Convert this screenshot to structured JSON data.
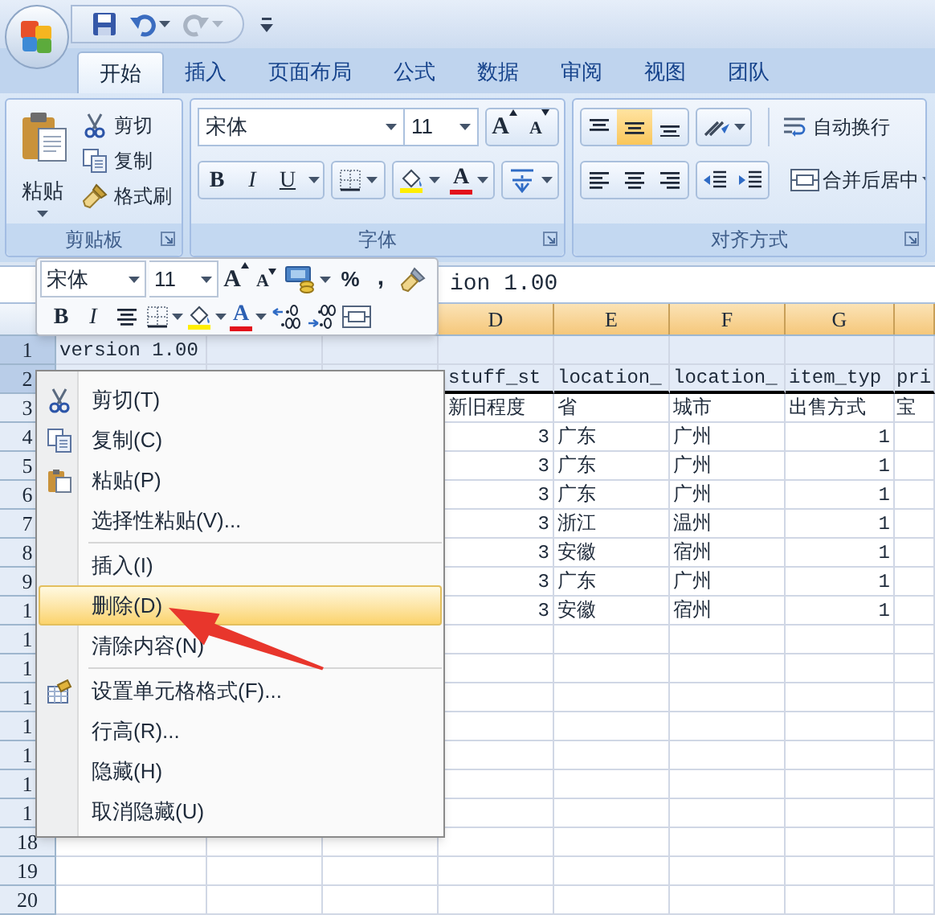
{
  "quick_access": [
    {
      "kind": "save",
      "disabled": false
    },
    {
      "kind": "undo",
      "disabled": false
    },
    {
      "kind": "redo",
      "disabled": true
    }
  ],
  "tabs": [
    {
      "label": "开始",
      "selected": true
    },
    {
      "label": "插入",
      "selected": false
    },
    {
      "label": "页面布局",
      "selected": false
    },
    {
      "label": "公式",
      "selected": false
    },
    {
      "label": "数据",
      "selected": false
    },
    {
      "label": "审阅",
      "selected": false
    },
    {
      "label": "视图",
      "selected": false
    },
    {
      "label": "团队",
      "selected": false
    }
  ],
  "ribbon": {
    "clipboard": {
      "label": "剪贴板",
      "paste": "粘贴",
      "commands": [
        {
          "kind": "cut",
          "label": "剪切"
        },
        {
          "kind": "copy",
          "label": "复制"
        },
        {
          "kind": "format_painter",
          "label": "格式刷"
        }
      ]
    },
    "font": {
      "label": "字体",
      "font_name": "宋体",
      "font_size": "11",
      "grow": "A",
      "shrink": "A",
      "styles": [
        "B",
        "I",
        "U"
      ],
      "font_color_letter": "A"
    },
    "alignment": {
      "label": "对齐方式",
      "vertical": [
        {
          "kind": "top",
          "selected": false
        },
        {
          "kind": "middle",
          "selected": true
        },
        {
          "kind": "bottom",
          "selected": false
        }
      ],
      "horizontal": [
        {
          "kind": "left",
          "selected": false
        },
        {
          "kind": "center",
          "selected": false
        },
        {
          "kind": "right",
          "selected": false
        }
      ],
      "wrap_text": "自动换行",
      "merge_center": "合并后居中"
    }
  },
  "formula_bar": {
    "value": "ion 1.00"
  },
  "mini_toolbar": {
    "font_name": "宋体",
    "font_size": "11",
    "grow": "A",
    "shrink": "A",
    "percent": "%",
    "comma": ",",
    "bold": "B",
    "italic": "I",
    "font_color_letter": "A"
  },
  "sheet": {
    "columns": [
      {
        "label": "D",
        "selected": true
      },
      {
        "label": "E",
        "selected": true
      },
      {
        "label": "F",
        "selected": true
      },
      {
        "label": "G",
        "selected": true
      },
      {
        "selected": true
      }
    ],
    "rows": [
      {
        "number": "1",
        "selected": true,
        "kind": "title",
        "a": "version 1.00"
      },
      {
        "number": "2",
        "selected": true,
        "kind": "fields",
        "d": "stuff_st",
        "e": "location_",
        "f": "location_",
        "g": "item_typ",
        "h": "pri"
      },
      {
        "number": "3",
        "selected": false,
        "kind": "text",
        "d": "新旧程度",
        "e": "省",
        "f": "城市",
        "g": "出售方式",
        "h": "宝"
      },
      {
        "number": "4",
        "selected": false,
        "kind": "data",
        "d": "3",
        "e": "广东",
        "f": "广州",
        "g": "1"
      },
      {
        "number": "5",
        "selected": false,
        "kind": "data",
        "d": "3",
        "e": "广东",
        "f": "广州",
        "g": "1"
      },
      {
        "number": "6",
        "selected": false,
        "kind": "data",
        "d": "3",
        "e": "广东",
        "f": "广州",
        "g": "1"
      },
      {
        "number": "7",
        "selected": false,
        "kind": "data",
        "d": "3",
        "e": "浙江",
        "f": "温州",
        "g": "1"
      },
      {
        "number": "8",
        "selected": false,
        "kind": "data",
        "d": "3",
        "e": "安徽",
        "f": "宿州",
        "g": "1"
      },
      {
        "number": "9",
        "selected": false,
        "kind": "data",
        "d": "3",
        "e": "广东",
        "f": "广州",
        "g": "1"
      },
      {
        "number": "1",
        "selected": false,
        "kind": "data",
        "d": "3",
        "e": "安徽",
        "f": "宿州",
        "g": "1"
      },
      {
        "number": "1",
        "selected": false,
        "kind": "blank"
      },
      {
        "number": "1",
        "selected": false,
        "kind": "blank"
      },
      {
        "number": "1",
        "selected": false,
        "kind": "blank"
      },
      {
        "number": "1",
        "selected": false,
        "kind": "blank"
      },
      {
        "number": "1",
        "selected": false,
        "kind": "blank"
      },
      {
        "number": "1",
        "selected": false,
        "kind": "blank"
      },
      {
        "number": "1",
        "selected": false,
        "kind": "blank"
      },
      {
        "number": "18",
        "selected": false,
        "kind": "blank"
      },
      {
        "number": "19",
        "selected": false,
        "kind": "blank"
      },
      {
        "number": "20",
        "selected": false,
        "kind": "blank"
      }
    ]
  },
  "context_menu": [
    {
      "kind": "cut",
      "label": "剪切(T)",
      "selected": false
    },
    {
      "kind": "copy",
      "label": "复制(C)",
      "selected": false
    },
    {
      "kind": "paste",
      "label": "粘贴(P)",
      "selected": false
    },
    {
      "kind": "item",
      "label": "选择性粘贴(V)...",
      "selected": false
    },
    {
      "kind": "separator"
    },
    {
      "kind": "item",
      "label": "插入(I)",
      "selected": false
    },
    {
      "kind": "item",
      "label": "删除(D)",
      "selected": true
    },
    {
      "kind": "item",
      "label": "清除内容(N)",
      "selected": false
    },
    {
      "kind": "separator"
    },
    {
      "kind": "format",
      "label": "设置单元格格式(F)...",
      "selected": false
    },
    {
      "kind": "item",
      "label": "行高(R)...",
      "selected": false
    },
    {
      "kind": "item",
      "label": "隐藏(H)",
      "selected": false
    },
    {
      "kind": "item",
      "label": "取消隐藏(U)",
      "selected": false
    }
  ],
  "annotation": {
    "kind": "arrow"
  }
}
